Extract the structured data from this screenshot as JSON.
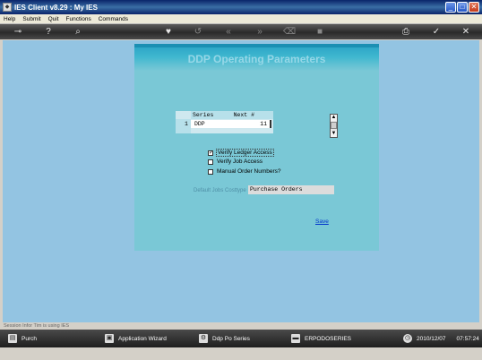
{
  "window": {
    "title": "IES Client v8.29 : My IES",
    "minimize": "_",
    "maximize": "□",
    "close": "✕"
  },
  "menu": [
    "Help",
    "Submit",
    "Quit",
    "Functions",
    "Commands"
  ],
  "toolbar": {
    "icons": [
      "key-icon",
      "help-icon",
      "search-icon",
      "heart-icon",
      "history-icon",
      "back-icon",
      "forward-icon",
      "trash-icon",
      "stop-icon",
      "print-icon",
      "ok-icon",
      "close-icon"
    ]
  },
  "panel": {
    "title": "DDP Operating Parameters",
    "grid": {
      "columns": [
        "Series",
        "Next #"
      ],
      "rows": [
        {
          "num": "1",
          "series": "DDP",
          "next": "11"
        }
      ]
    },
    "checkboxes": [
      {
        "label": "Verify Ledger Access",
        "checked": true
      },
      {
        "label": "Verify Job Access",
        "checked": false
      },
      {
        "label": "Manual Order Numbers?",
        "checked": false
      }
    ],
    "default_jobs_label": "Default Jobs Costtype",
    "default_jobs_value": "Purchase Orders",
    "save_label": "Save"
  },
  "status": {
    "session_info": "Session Infor Tim is using IES"
  },
  "taskbar": {
    "items": [
      {
        "label": "Purch",
        "icon": "document-icon"
      },
      {
        "label": "Application Wizard",
        "icon": "wizard-icon"
      },
      {
        "label": "Ddp Po Series",
        "icon": "settings-icon"
      },
      {
        "label": "ERPODOSERIES",
        "icon": "car-icon"
      }
    ],
    "date": "2010/12/07",
    "time": "07:57:24"
  }
}
